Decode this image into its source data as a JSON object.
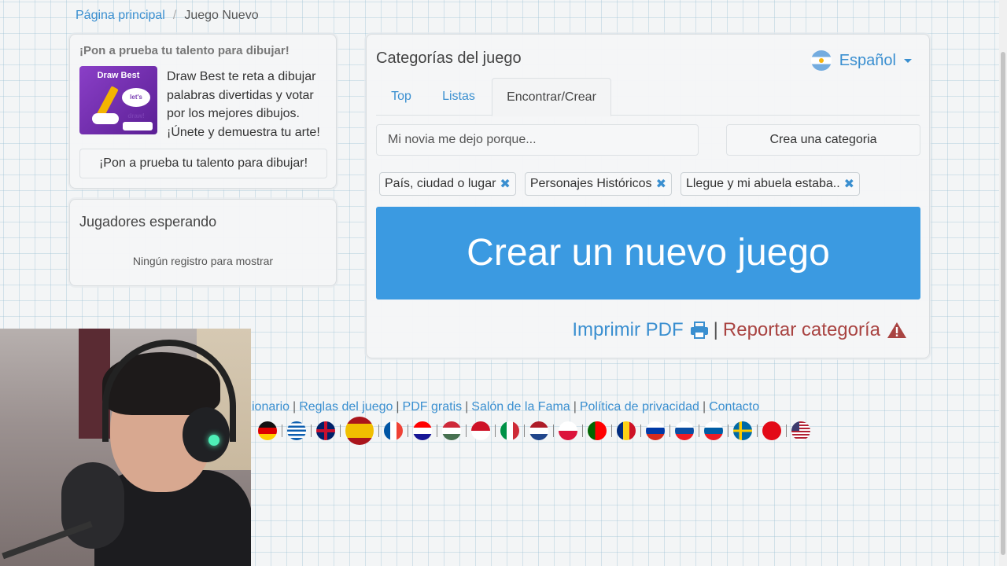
{
  "breadcrumb": {
    "home": "Página principal",
    "separator": "/",
    "current": "Juego Nuevo"
  },
  "promo": {
    "title": "¡Pon a prueba tu talento para dibujar!",
    "image_label": "Draw Best",
    "image_bubble": "let's draw!",
    "description": "Draw Best te reta a dibujar palabras divertidas y votar por los mejores dibujos. ¡Únete y demuestra tu arte!",
    "button": "¡Pon a prueba tu talento para dibujar!"
  },
  "players": {
    "title": "Jugadores esperando",
    "empty": "Ningún registro para mostrar"
  },
  "main": {
    "title": "Categorías del juego",
    "language": "Español",
    "tabs": [
      {
        "label": "Top"
      },
      {
        "label": "Listas"
      },
      {
        "label": "Encontrar/Crear",
        "active": true
      }
    ],
    "search_placeholder": "Mi novia me dejo porque...",
    "create_category": "Crea una categoria",
    "selected_categories": [
      {
        "label": "País, ciudad o lugar"
      },
      {
        "label": "Personajes Históricos"
      },
      {
        "label": "Llegue y mi abuela estaba.."
      }
    ],
    "create_game": "Crear un nuevo juego",
    "print_pdf": "Imprimir PDF",
    "action_separator": "|",
    "report": "Reportar categoría"
  },
  "footer": {
    "links": [
      "ionario",
      "Reglas del juego",
      "PDF gratis",
      "Salón de la Fama",
      "Política de privacidad",
      "Contacto"
    ]
  },
  "flags": [
    "de",
    "gr",
    "gb",
    "es",
    "fr",
    "hr",
    "hu",
    "id",
    "it",
    "nl",
    "pl",
    "pt",
    "ro",
    "ru",
    "sk",
    "si",
    "se",
    "tr",
    "us"
  ],
  "colors": {
    "primary": "#3b9ae1",
    "link": "#3a8fd0",
    "danger": "#a94442"
  }
}
